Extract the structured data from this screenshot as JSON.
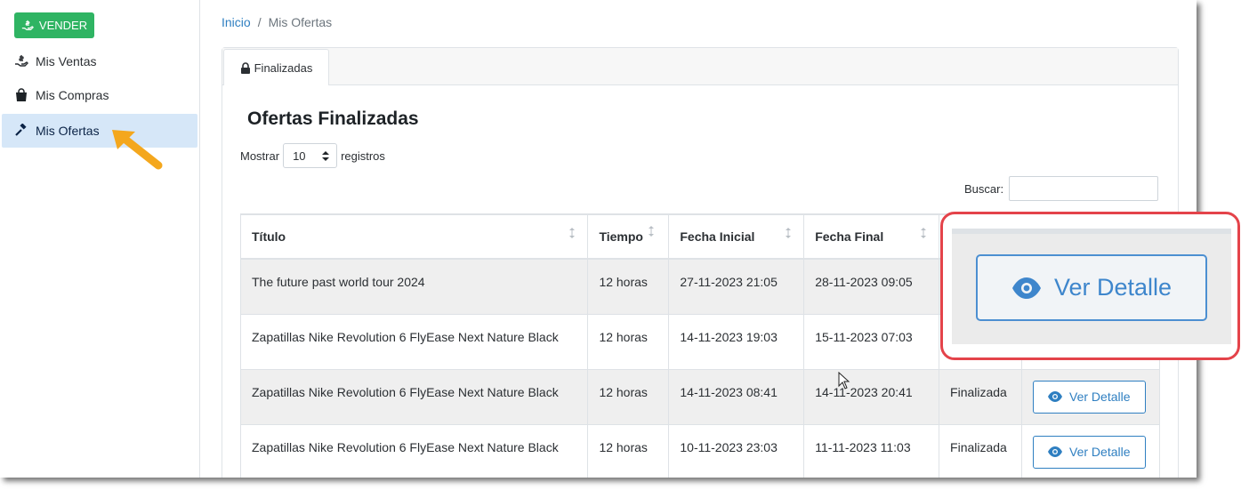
{
  "sidebar": {
    "sell_button": "VENDER",
    "items": [
      {
        "label": "Mis Ventas",
        "icon": "hand-holding-dollar-icon"
      },
      {
        "label": "Mis Compras",
        "icon": "shopping-bag-icon"
      },
      {
        "label": "Mis Ofertas",
        "icon": "gavel-icon",
        "active": true
      }
    ]
  },
  "breadcrumb": {
    "home": "Inicio",
    "separator": "/",
    "current": "Mis Ofertas"
  },
  "tab": {
    "label": "Finalizadas",
    "icon": "lock-icon"
  },
  "page_title": "Ofertas Finalizadas",
  "length": {
    "prefix": "Mostrar",
    "value": "10",
    "suffix": "registros"
  },
  "search": {
    "label": "Buscar:",
    "value": ""
  },
  "table": {
    "headers": [
      "Título",
      "Tiempo",
      "Fecha Inicial",
      "Fecha Final",
      "",
      ""
    ],
    "rows": [
      {
        "title": "The future past world tour 2024",
        "time": "12 horas",
        "start": "27-11-2023 21:05",
        "end": "28-11-2023 09:05",
        "status": "",
        "action": "Ver Detalle"
      },
      {
        "title": "Zapatillas Nike Revolution 6 FlyEase Next Nature Black",
        "time": "12 horas",
        "start": "14-11-2023 19:03",
        "end": "15-11-2023 07:03",
        "status": "",
        "action": "Ver Detalle"
      },
      {
        "title": "Zapatillas Nike Revolution 6 FlyEase Next Nature Black",
        "time": "12 horas",
        "start": "14-11-2023 08:41",
        "end": "14-11-2023 20:41",
        "status": "Finalizada",
        "action": "Ver Detalle"
      },
      {
        "title": "Zapatillas Nike Revolution 6 FlyEase Next Nature Black",
        "time": "12 horas",
        "start": "10-11-2023 23:03",
        "end": "11-11-2023 11:03",
        "status": "Finalizada",
        "action": "Ver Detalle"
      }
    ]
  },
  "zoom_callout": {
    "button_label": "Ver Detalle"
  },
  "colors": {
    "accent": "#2f7fc1",
    "success": "#2fb463",
    "highlight_border": "#e4434a",
    "arrow": "#f4a71d",
    "active_nav": "#d6e7f8"
  }
}
